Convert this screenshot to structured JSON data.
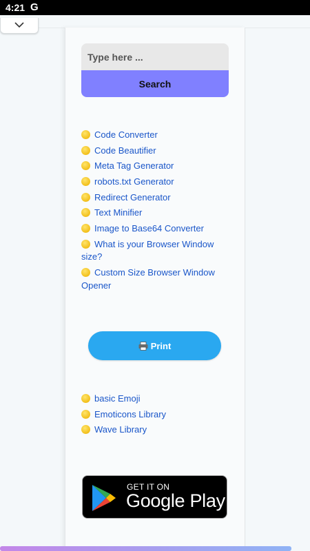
{
  "status_bar": {
    "time": "4:21",
    "app_icon": "G"
  },
  "search": {
    "placeholder": "Type here ...",
    "button_label": "Search"
  },
  "tools_links": [
    "Code Converter",
    "Code Beautifier",
    "Meta Tag Generator",
    "robots.txt Generator",
    "Redirect Generator",
    "Text Minifier",
    "Image to Base64 Converter",
    "What is your Browser Window size?",
    "Custom Size Browser Window Opener"
  ],
  "print_button": {
    "label": "Print",
    "icon": "printer-icon"
  },
  "emoji_links": [
    "basic Emoji",
    "Emoticons Library",
    "Wave Library"
  ],
  "google_play_badge": {
    "small_text": "GET IT ON",
    "large_text": "Google Play"
  },
  "colors": {
    "search_button": "#8080ff",
    "print_button": "#2aa8f0",
    "link": "#1a56c9",
    "bullet": "#f2bf1a"
  }
}
